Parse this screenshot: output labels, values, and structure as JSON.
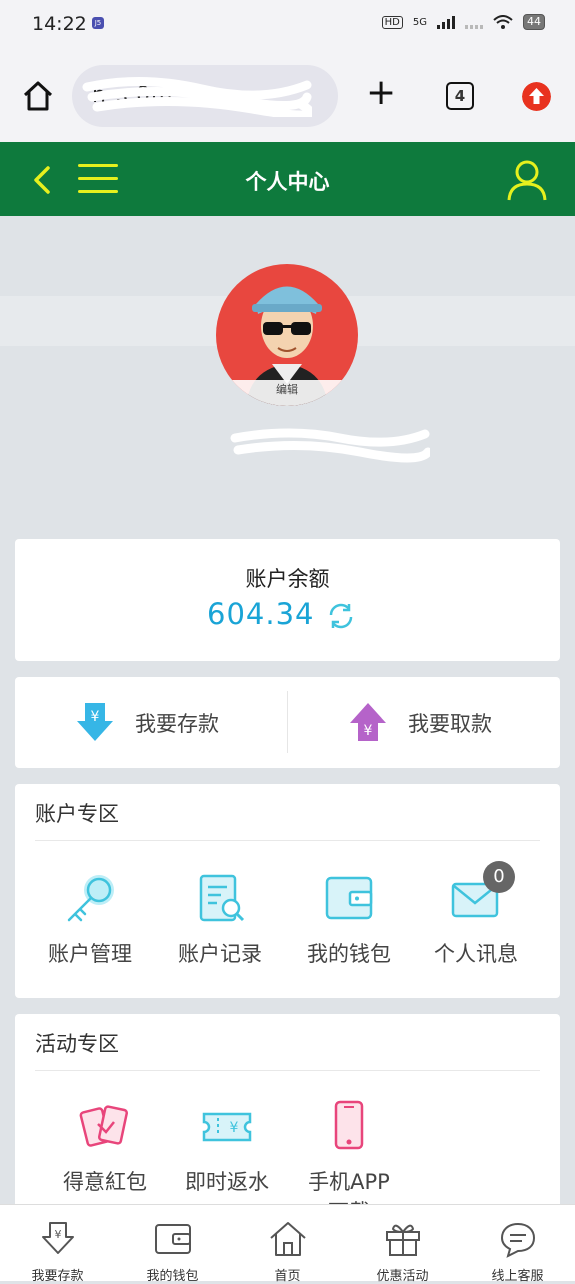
{
  "status_bar": {
    "time": "14:22",
    "app_badge": "J5",
    "hd": "HD",
    "network": "5G",
    "battery": "44"
  },
  "browser": {
    "url_visible": "h        .c0m",
    "tabs_count": "4"
  },
  "header": {
    "title": "个人中心"
  },
  "profile": {
    "edit_label": "编辑"
  },
  "balance": {
    "label": "账户余额",
    "amount": "604.34"
  },
  "actions": {
    "deposit": "我要存款",
    "withdraw": "我要取款"
  },
  "account_zone": {
    "title": "账户专区",
    "items": [
      {
        "label": "账户管理",
        "icon": "key-icon"
      },
      {
        "label": "账户记录",
        "icon": "record-icon"
      },
      {
        "label": "我的钱包",
        "icon": "wallet-icon"
      },
      {
        "label": "个人讯息",
        "icon": "mail-icon"
      }
    ],
    "unread_count": "0"
  },
  "activity_zone": {
    "title": "活动专区",
    "items": [
      {
        "label": "得意紅包",
        "icon": "red-envelope-icon"
      },
      {
        "label": "即时返水",
        "icon": "rebate-ticket-icon"
      },
      {
        "label": "手机APP",
        "label2": "下载",
        "icon": "phone-icon"
      }
    ]
  },
  "bottom_nav": [
    {
      "label": "我要存款",
      "icon": "deposit-icon"
    },
    {
      "label": "我的钱包",
      "icon": "wallet-icon"
    },
    {
      "label": "首页",
      "icon": "home-icon"
    },
    {
      "label": "优惠活动",
      "icon": "gift-icon"
    },
    {
      "label": "线上客服",
      "icon": "chat-icon"
    }
  ],
  "colors": {
    "header_green": "#0e7a3d",
    "accent_yellow": "#e6f01e",
    "amount_blue": "#1aa4d6",
    "icon_cyan": "#3fc3dd",
    "icon_pink": "#e8457b"
  }
}
